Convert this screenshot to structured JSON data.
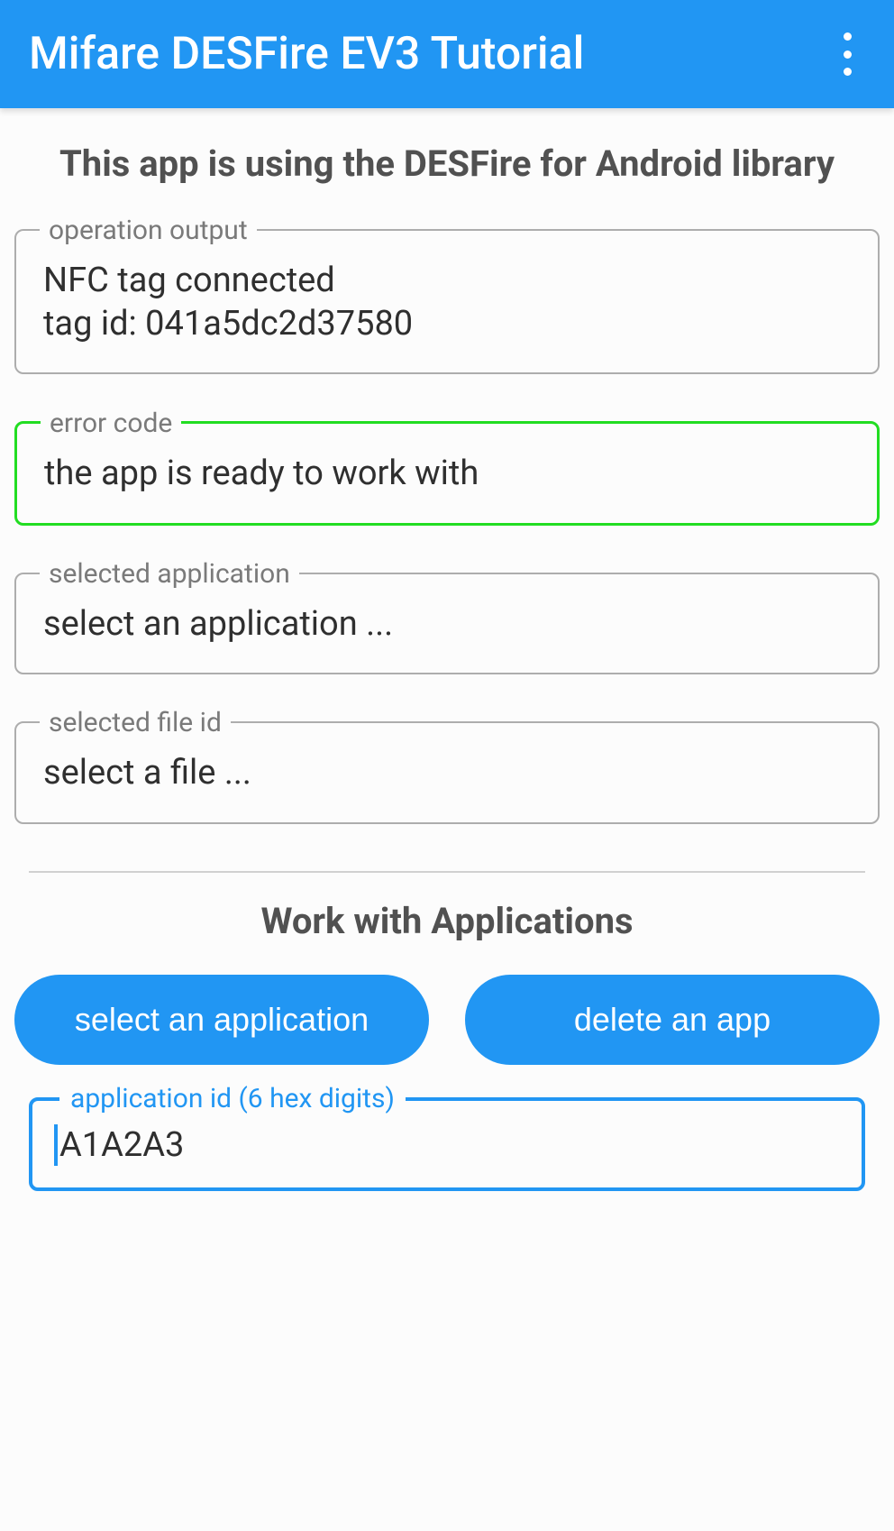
{
  "appbar": {
    "title": "Mifare DESFire EV3 Tutorial"
  },
  "subtitle": "This app is using the DESFire for Android library",
  "fields": {
    "operation_output": {
      "label": "operation output",
      "value": "NFC tag connected\ntag id: 041a5dc2d37580"
    },
    "error_code": {
      "label": "error code",
      "value": "the app is ready to work with"
    },
    "selected_application": {
      "label": "selected application",
      "value": "select an application ..."
    },
    "selected_file_id": {
      "label": "selected file id",
      "value": "select a file ..."
    }
  },
  "section": {
    "title": "Work with Applications"
  },
  "buttons": {
    "select_app": "select an application",
    "delete_app": "delete an app"
  },
  "app_id_field": {
    "label": "application id (6 hex digits)",
    "value": "A1A2A3"
  }
}
